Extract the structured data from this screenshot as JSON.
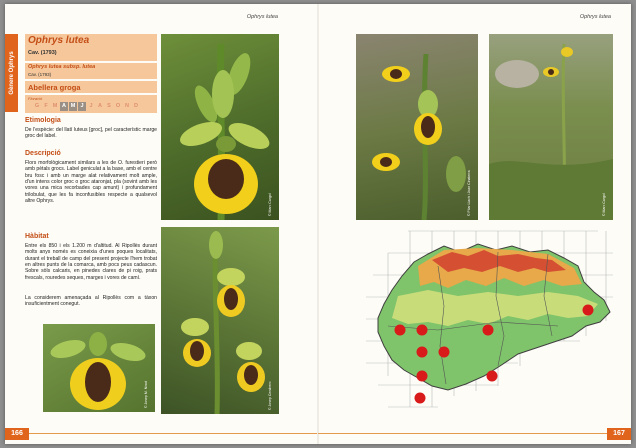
{
  "left_page": {
    "running_head": "Ophrys lutea",
    "side_tab": "Gènere Ophrys",
    "species": {
      "name": "Ophrys lutea",
      "author": "Cav. (1793)"
    },
    "subspecies": {
      "name": "Ophrys lutea subsp. lutea",
      "author": "Cav. (1793)"
    },
    "common_name": "Abellera groga",
    "flowering": {
      "label": "Floració",
      "months": [
        {
          "m": "G",
          "on": false
        },
        {
          "m": "F",
          "on": false
        },
        {
          "m": "M",
          "on": false
        },
        {
          "m": "A",
          "on": true
        },
        {
          "m": "M",
          "on": true
        },
        {
          "m": "J",
          "on": true
        },
        {
          "m": "J",
          "on": false
        },
        {
          "m": "A",
          "on": false
        },
        {
          "m": "S",
          "on": false
        },
        {
          "m": "O",
          "on": false
        },
        {
          "m": "N",
          "on": false
        },
        {
          "m": "D",
          "on": false
        }
      ]
    },
    "sections": {
      "etimologia_title": "Etimologia",
      "etimologia_text": "De l'espècie: del llatí luteus [groc], pel caracte­rístic marge groc del label.",
      "descripcio_title": "Descripció",
      "descripcio_text": "Flors morfològicament similars a les de O. fu­restieri però amb pètals grocs. Label geniculat a la base, amb el centre bru fosc i amb un marge alat relativament molt ample, d'un intens color groc o groc ataronjat, pla (sovint amb les vores una mica recorbades cap amunt) i profunda­ment trilobulat, que les fa inconfusibles respecte a qualsevol altre Ophrys.",
      "habitat_title": "Hàbitat",
      "habitat_text_1": "Entre els 850 i els 1.200 m d'altitud. Al Ripol­lès durant molts anys només es coneixia d'unes poques localitats, durant el treball de camp del present projecte l'hem trobat en altres punts de la comarca, amb pocs peus cadascun. Sobre sòls calcaris, en pinedes clares de pi roig, prats fres­cals, rouredes seques, marges i vores de camí.",
      "habitat_text_2": "La considerem amenaçada al Ripollès com a tàxon insuficientment conegut."
    },
    "credits": [
      "© Marc Cargol",
      "© Josep Cendrero",
      "© Josep M. Ninot"
    ],
    "page_number": "166"
  },
  "right_page": {
    "running_head": "Ophrys lutea",
    "credits": [
      "© Pilar Llach i Joan Cinaterra",
      "© Marc Cargol"
    ],
    "page_number": "167"
  },
  "colors": {
    "accent": "#e0641c",
    "header_bg": "#f5c79b",
    "title": "#c44e16",
    "dot": "#d91a1a"
  }
}
